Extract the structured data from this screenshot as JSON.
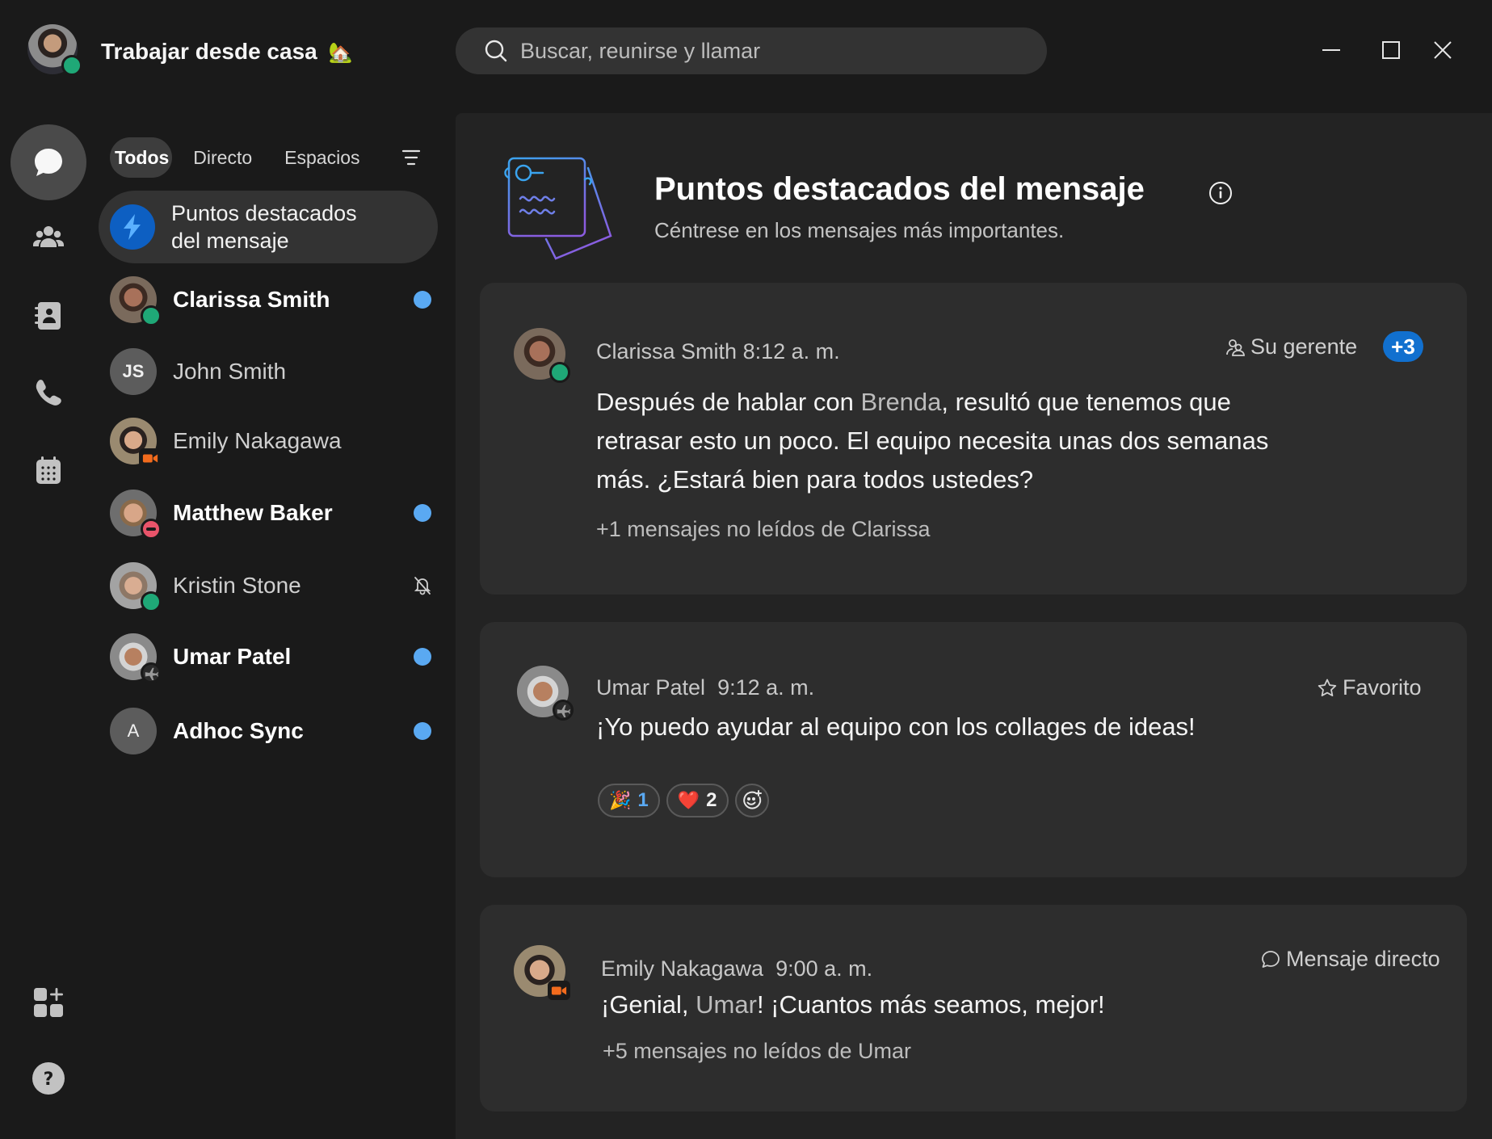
{
  "titlebar": {
    "status_text": "Trabajar desde casa",
    "status_emoji": "🏡",
    "search_placeholder": "Buscar, reunirse y llamar",
    "window_controls": [
      "minimize",
      "maximize",
      "close"
    ]
  },
  "rail": {
    "items": [
      {
        "id": "messaging",
        "icon": "chat-bubble-icon",
        "active": true
      },
      {
        "id": "teams",
        "icon": "people-icon",
        "active": false
      },
      {
        "id": "contacts",
        "icon": "contacts-book-icon",
        "active": false
      },
      {
        "id": "calling",
        "icon": "phone-icon",
        "active": false
      },
      {
        "id": "meetings",
        "icon": "calendar-icon",
        "active": false
      }
    ],
    "bottom": [
      {
        "id": "apps",
        "icon": "add-apps-icon"
      },
      {
        "id": "help",
        "icon": "help-icon"
      }
    ]
  },
  "list": {
    "tabs": [
      {
        "label": "Todos",
        "active": true
      },
      {
        "label": "Directo",
        "active": false
      },
      {
        "label": "Espacios",
        "active": false
      }
    ],
    "highlight_item": {
      "label_line1": "Puntos destacados",
      "label_line2": "del mensaje"
    },
    "conversations": [
      {
        "name": "Clarissa Smith",
        "unread": true,
        "presence": "active",
        "avatar": "photo",
        "indicator": "unread-dot"
      },
      {
        "name": "John Smith",
        "unread": false,
        "presence": "none",
        "avatar": "initials",
        "initials": "JS",
        "indicator": "none"
      },
      {
        "name": "Emily Nakagawa",
        "unread": false,
        "presence": "in-meeting",
        "avatar": "photo",
        "indicator": "none"
      },
      {
        "name": "Matthew Baker",
        "unread": true,
        "presence": "do-not-disturb",
        "avatar": "photo",
        "indicator": "unread-dot"
      },
      {
        "name": "Kristin Stone",
        "unread": false,
        "presence": "active",
        "avatar": "photo",
        "indicator": "muted"
      },
      {
        "name": "Umar Patel",
        "unread": true,
        "presence": "away-travel",
        "avatar": "photo",
        "indicator": "unread-dot"
      },
      {
        "name": "Adhoc Sync",
        "unread": true,
        "presence": "none",
        "avatar": "initials",
        "initials": "A",
        "indicator": "unread-dot"
      }
    ]
  },
  "main": {
    "title": "Puntos destacados del mensaje",
    "subtitle": "Céntrese en los mensajes más importantes.",
    "cards": [
      {
        "author": "Clarissa Smith",
        "time": "8:12 a. m.",
        "tag": "Su gerente",
        "extra_count": "+3",
        "body_before": "Después de hablar con ",
        "mention": "Brenda",
        "body_after": ", resultó que tenemos que retrasar esto un poco. El equipo necesita unas dos semanas más. ¿Estará bien para todos ustedes?",
        "more": "+1 mensajes no leídos de Clarissa"
      },
      {
        "author": "Umar Patel",
        "time": "9:12 a. m.",
        "tag": "Favorito",
        "body": "¡Yo puedo ayudar al equipo con los collages de ideas!",
        "reactions": [
          {
            "emoji": "🎉",
            "count": "1",
            "mine": true
          },
          {
            "emoji": "❤️",
            "count": "2",
            "mine": false
          }
        ]
      },
      {
        "author": "Emily Nakagawa",
        "time": "9:00 a. m.",
        "tag": "Mensaje directo",
        "body_before": "¡Genial, ",
        "mention": "Umar",
        "body_after": "! ¡Cuantos más seamos, mejor!",
        "more": "+5 mensajes no leídos de Umar"
      }
    ]
  },
  "colors": {
    "background": "#1a1a1a",
    "panel": "#232323",
    "card": "#2d2d2d",
    "accent_blue": "#1170cf",
    "unread_dot": "#5aa9f2",
    "presence_active": "#1fa877",
    "presence_dnd": "#e9546a",
    "presence_meeting": "#f26b1d"
  }
}
